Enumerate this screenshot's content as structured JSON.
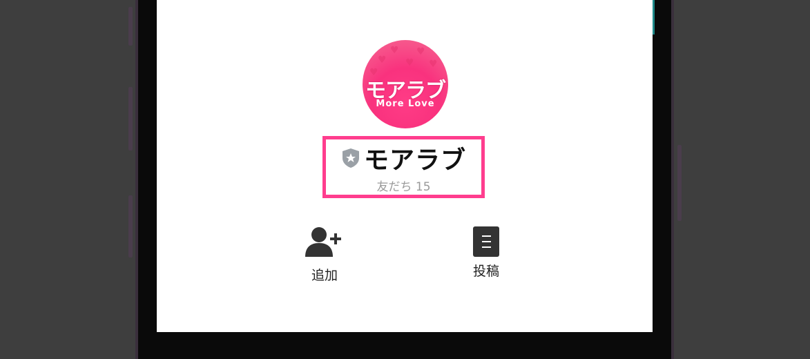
{
  "account": {
    "logo_text": "モアラブ",
    "logo_subtext": "More Love",
    "name": "モアラブ",
    "friends_label": "友だち",
    "friends_count": "15"
  },
  "actions": {
    "add_label": "追加",
    "post_label": "投稿"
  },
  "colors": {
    "highlight": "#ff3d8e",
    "logo_pink": "#f9327e",
    "icon_dark": "#333333",
    "shield_gray": "#9aa0a6"
  },
  "icons": {
    "badge": "shield-star-icon",
    "add": "add-friend-icon",
    "post": "document-icon"
  }
}
